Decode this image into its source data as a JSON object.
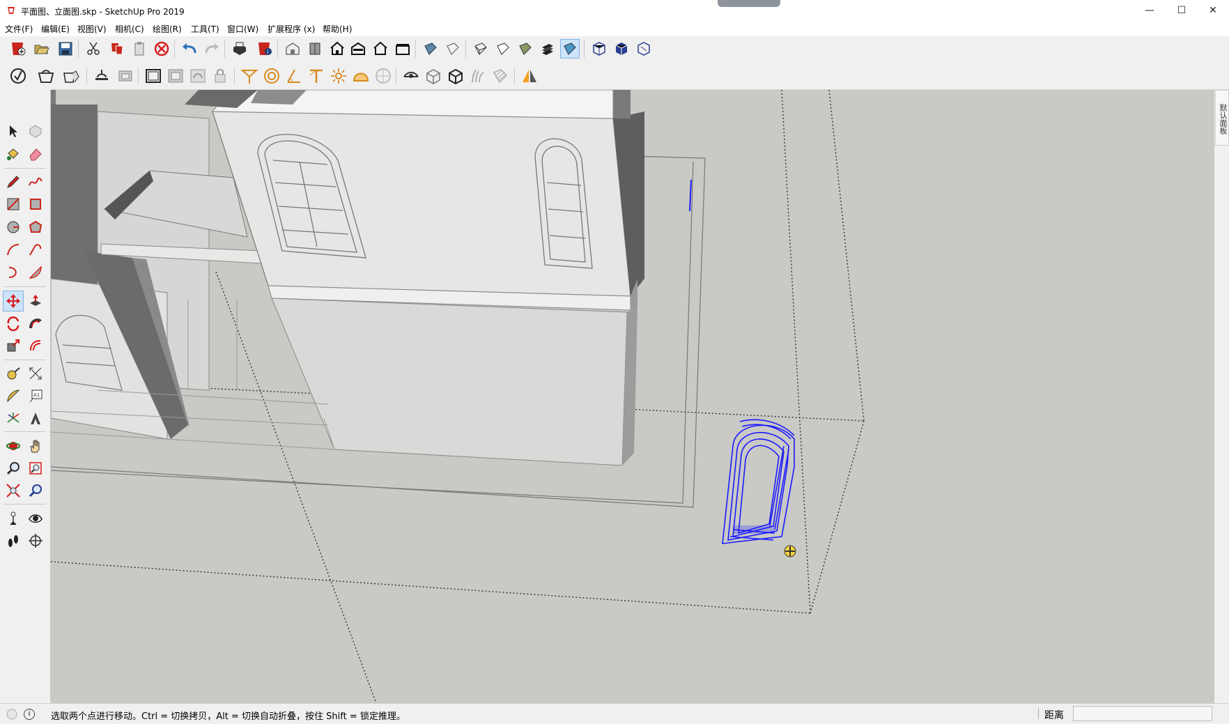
{
  "window": {
    "title": "平面图、立面图.skp - SketchUp Pro 2019",
    "minimize_glyph": "—",
    "maximize_glyph": "☐",
    "close_glyph": "✕"
  },
  "menu": [
    "文件(F)",
    "编辑(E)",
    "视图(V)",
    "相机(C)",
    "绘图(R)",
    "工具(T)",
    "窗口(W)",
    "扩展程序 (x)",
    "帮助(H)"
  ],
  "toolbar_top": [
    "new-icon",
    "open-icon",
    "save-icon",
    "cut-icon",
    "copy-icon",
    "paste-icon",
    "erase-icon",
    "undo-icon",
    "redo-icon",
    "print-icon",
    "model-info-icon",
    "iso-view-icon",
    "top-view-icon",
    "front-view-icon",
    "right-view-icon",
    "back-view-icon",
    "left-view-icon",
    "xray-icon",
    "back-edges-icon",
    "wireframe-icon",
    "hidden-line-icon",
    "shaded-icon",
    "shaded-textures-icon",
    "monochrome-icon",
    "section-plane-icon",
    "section-fill-icon",
    "section-cuts-icon"
  ],
  "toolbar_second": [
    "sandbox-icon",
    "warehouse-icon",
    "extension-warehouse-icon",
    "layout-icon",
    "send-to-layout-icon",
    "component-icon",
    "group-icon",
    "solid-outer-shell-icon",
    "lock-icon",
    "protractor-icon",
    "circle-icon",
    "angle-icon",
    "text-icon",
    "sun-icon",
    "dome-icon",
    "sphere-icon",
    "eye-icon",
    "cube-icon",
    "cube-dark-icon",
    "grass-icon",
    "hatch-icon",
    "mirror-icon"
  ],
  "left_tools": [
    "select-icon",
    "make-component-icon",
    "paint-bucket-icon",
    "eraser-icon",
    "pencil-icon",
    "freehand-icon",
    "rectangle-icon",
    "rotated-rectangle-icon",
    "circle-tool-icon",
    "polygon-icon",
    "arc-icon",
    "two-point-arc-icon",
    "three-point-arc-icon",
    "pie-icon",
    "move-icon",
    "push-pull-icon",
    "rotate-icon",
    "follow-me-icon",
    "scale-icon",
    "offset-icon",
    "tape-measure-icon",
    "dimension-icon",
    "protractor-tool-icon",
    "text-tool-icon",
    "axes-icon",
    "3d-text-icon",
    "orbit-icon",
    "pan-icon",
    "zoom-icon",
    "zoom-window-icon",
    "zoom-extents-icon",
    "previous-view-icon",
    "position-camera-icon",
    "look-around-icon",
    "walk-icon",
    "section-plane-tool-icon"
  ],
  "active_left_tool": "move-icon",
  "active_top_tool": "shaded-textures-icon",
  "trays_tab": "默认面板",
  "status": {
    "hint": "选取两个点进行移动。Ctrl = 切换拷贝，Alt = 切换自动折叠，按住 Shift = 锁定推理。",
    "measure_label": "距离",
    "measure_value": ""
  },
  "colors": {
    "viewport_bg": "#c9c9c6",
    "selection_blue": "#1a1aff",
    "active_tool_bg": "#cde3f7"
  }
}
